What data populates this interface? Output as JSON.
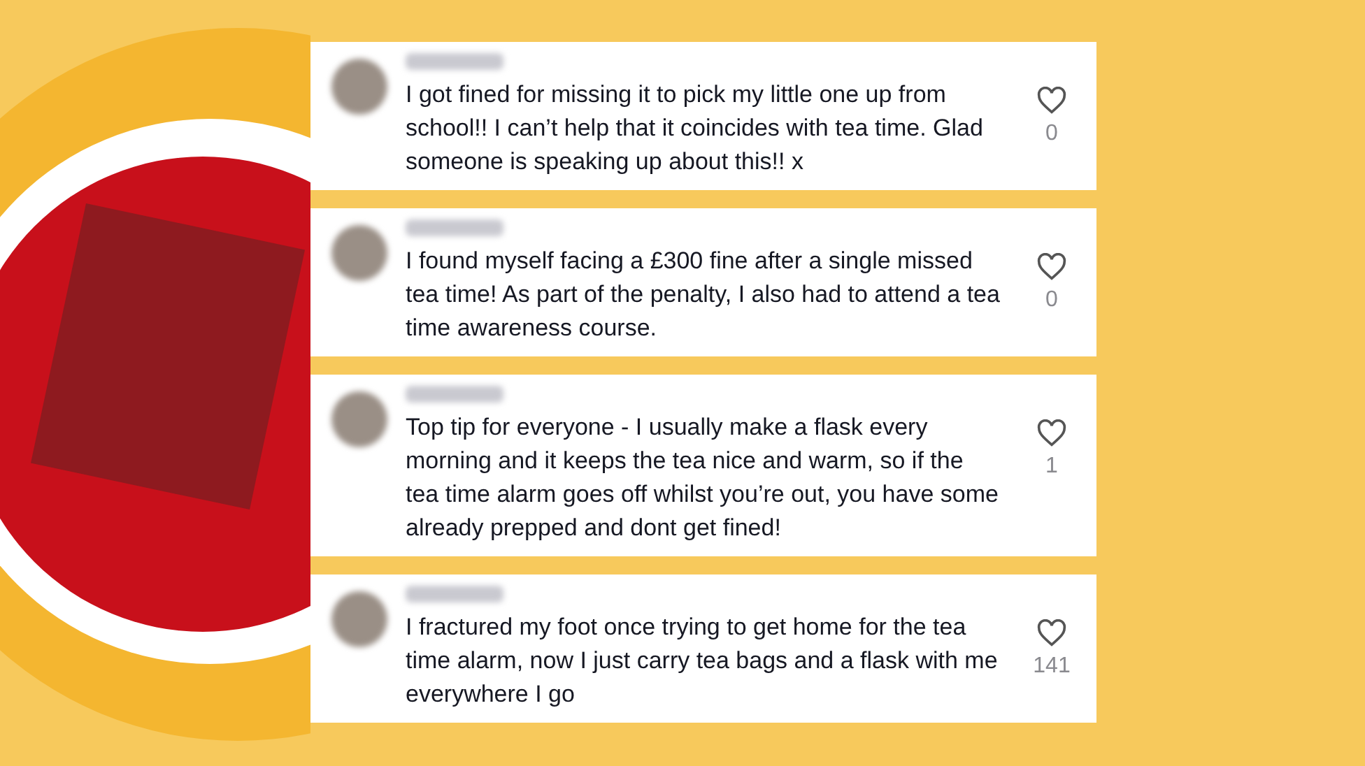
{
  "comments": [
    {
      "text": "I got fined for missing it to pick my little one up from school!! I can’t help that it coincides with tea time. Glad someone is speaking up about this!! x",
      "likes": "0"
    },
    {
      "text": "I found myself facing a £300 fine after a single missed tea time! As part of the penalty, I also had to attend a tea time awareness course.",
      "likes": "0"
    },
    {
      "text": "Top tip for everyone - I usually make a flask every morning and it keeps the tea nice and warm, so if the tea time alarm goes off whilst you’re out, you have some already prepped and dont get fined!",
      "likes": "1"
    },
    {
      "text": "I fractured my foot once trying to get home for the tea time alarm, now I just carry tea bags and a flask with me everywhere I go",
      "likes": "141"
    }
  ]
}
